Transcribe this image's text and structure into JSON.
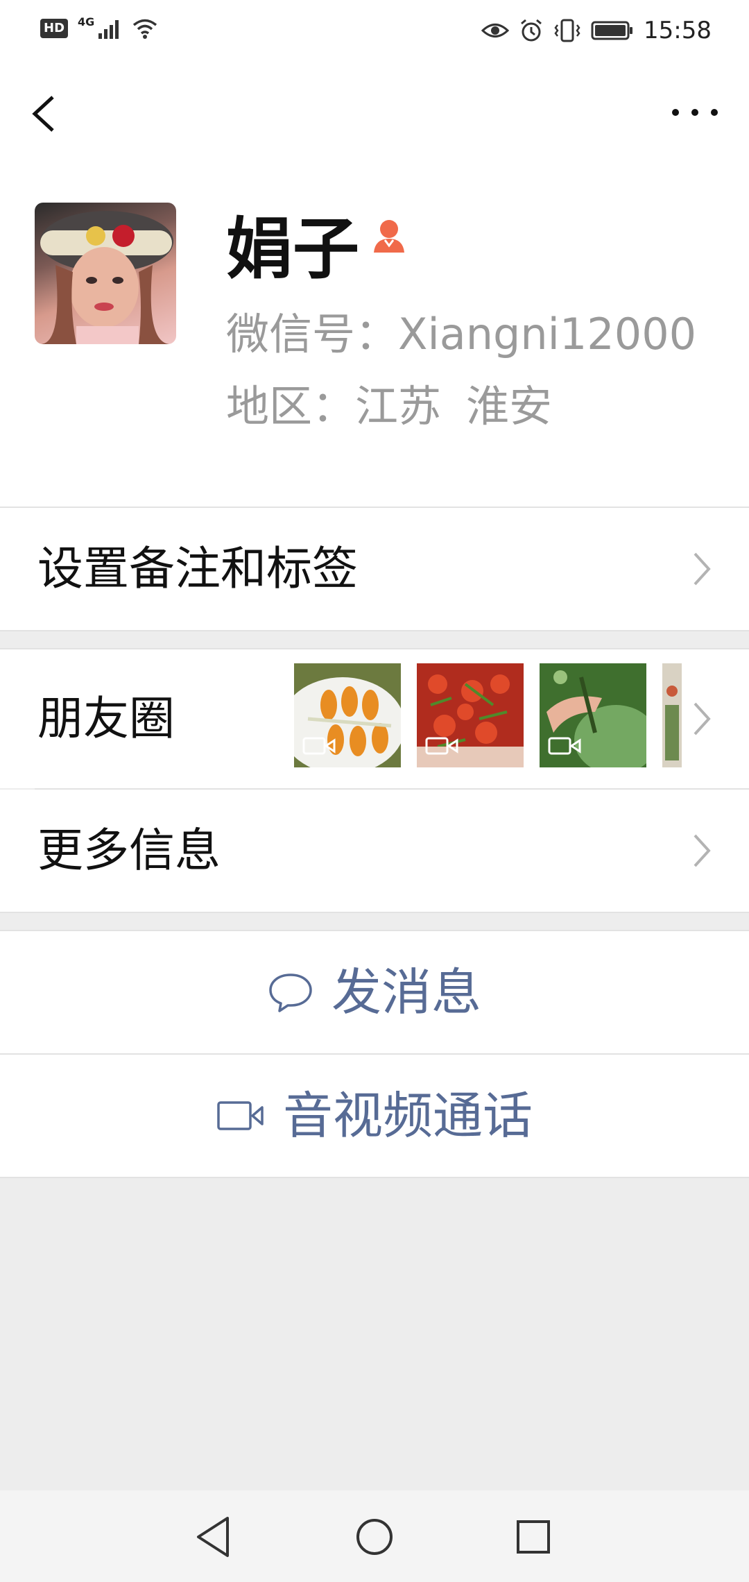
{
  "status_bar": {
    "network_label": "HD",
    "network_type": "4G",
    "time": "15:58",
    "icons": [
      "hd-icon",
      "signal-icon",
      "wifi-icon",
      "eye-icon",
      "alarm-icon",
      "vibrate-icon",
      "battery-icon"
    ]
  },
  "topbar": {
    "back_icon": "chevron-left-icon",
    "more_icon": "more-dots-icon"
  },
  "profile": {
    "name": "娟子",
    "gender_icon": "female-icon",
    "gender_color": "#f06a4a",
    "wechat_id": "微信号：Xiangni12000",
    "region_label": "地区：",
    "region_province": "江苏",
    "region_city": "淮安"
  },
  "rows": {
    "remark_tags": "设置备注和标签",
    "moments": "朋友圈",
    "more_info": "更多信息"
  },
  "actions": {
    "send_message": "发消息",
    "video_call": "音视频通话",
    "accent_color": "#576b95"
  }
}
